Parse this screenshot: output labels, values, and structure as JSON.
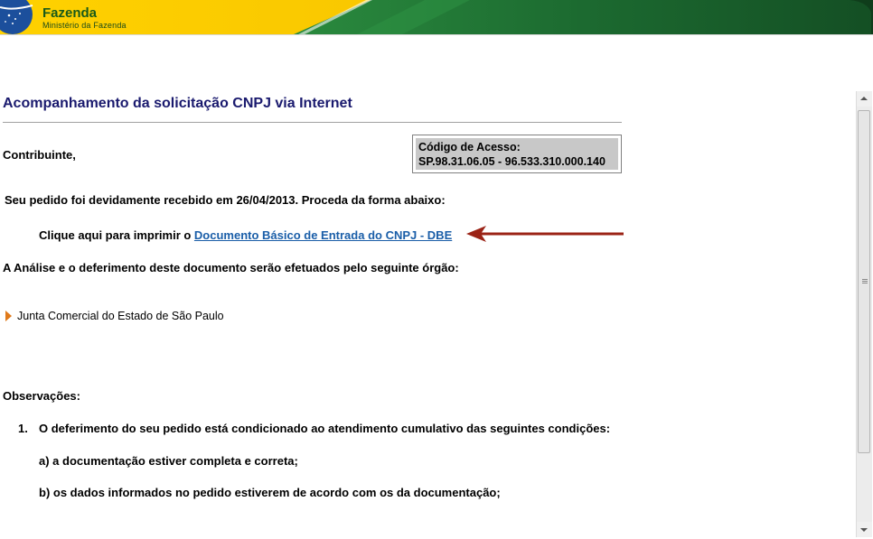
{
  "header": {
    "brand_title": "Fazenda",
    "brand_subtitle": "Ministério da Fazenda"
  },
  "page": {
    "title": "Acompanhamento da solicitação CNPJ via Internet",
    "greeting": "Contribuinte,",
    "access": {
      "label": "Código de Acesso:",
      "code": "SP.98.31.06.05 - 96.533.310.000.140"
    },
    "received_text": "Seu pedido foi devidamente recebido em 26/04/2013. Proceda da forma abaixo:",
    "print_prefix": "Clique aqui para imprimir o ",
    "print_link": "Documento Básico de Entrada do CNPJ - DBE",
    "analysis_text": "A Análise e o deferimento deste documento serão efetuados pelo seguinte órgão:",
    "organ": "Junta Comercial do Estado de São Paulo",
    "observations_title": "Observações:",
    "observations": [
      {
        "number": "1.",
        "text": "O deferimento do seu pedido está condicionado ao atendimento cumulativo das seguintes condições:",
        "conditions": [
          "a) a documentação estiver completa e correta;",
          "b) os dados informados no pedido estiverem de acordo com os da documentação;"
        ]
      }
    ]
  },
  "colors": {
    "title": "#1a1a6e",
    "link": "#1a5ea8",
    "arrow": "#9b2316",
    "bullet": "#e07a1a",
    "banner_green": "#1f6b32",
    "banner_yellow": "#f2c200"
  }
}
